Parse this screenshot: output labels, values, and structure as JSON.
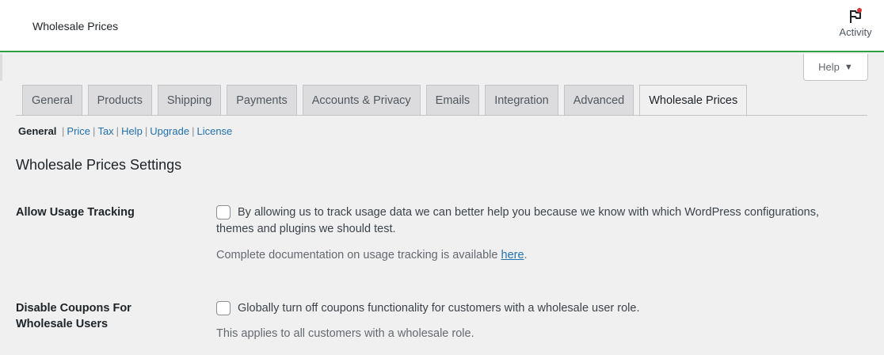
{
  "header": {
    "title": "Wholesale Prices",
    "activity_label": "Activity",
    "activity_icon": "flag-icon",
    "accent_color": "#2ea043"
  },
  "help": {
    "label": "Help",
    "caret": "▼"
  },
  "tabs": [
    {
      "label": "General"
    },
    {
      "label": "Products"
    },
    {
      "label": "Shipping"
    },
    {
      "label": "Payments"
    },
    {
      "label": "Accounts & Privacy"
    },
    {
      "label": "Emails"
    },
    {
      "label": "Integration"
    },
    {
      "label": "Advanced"
    },
    {
      "label": "Wholesale Prices",
      "active": true
    }
  ],
  "subnav": {
    "current": "General",
    "links": [
      "Price",
      "Tax",
      "Help",
      "Upgrade",
      "License"
    ]
  },
  "section": {
    "title": "Wholesale Prices Settings"
  },
  "settings": [
    {
      "label": "Allow Usage Tracking",
      "checked": false,
      "text_line1": "By allowing us to track usage data we can better help you because we know with which WordPress configurations,",
      "text_line2": "themes and plugins we should test.",
      "description": "Complete documentation on usage tracking is available ",
      "description_link": "here",
      "description_end": "."
    },
    {
      "label_line1": "Disable Coupons For",
      "label_line2": "Wholesale Users",
      "checked": false,
      "text_line1": "Globally turn off coupons functionality for customers with a wholesale user role.",
      "description": "This applies to all customers with a wholesale role."
    }
  ]
}
